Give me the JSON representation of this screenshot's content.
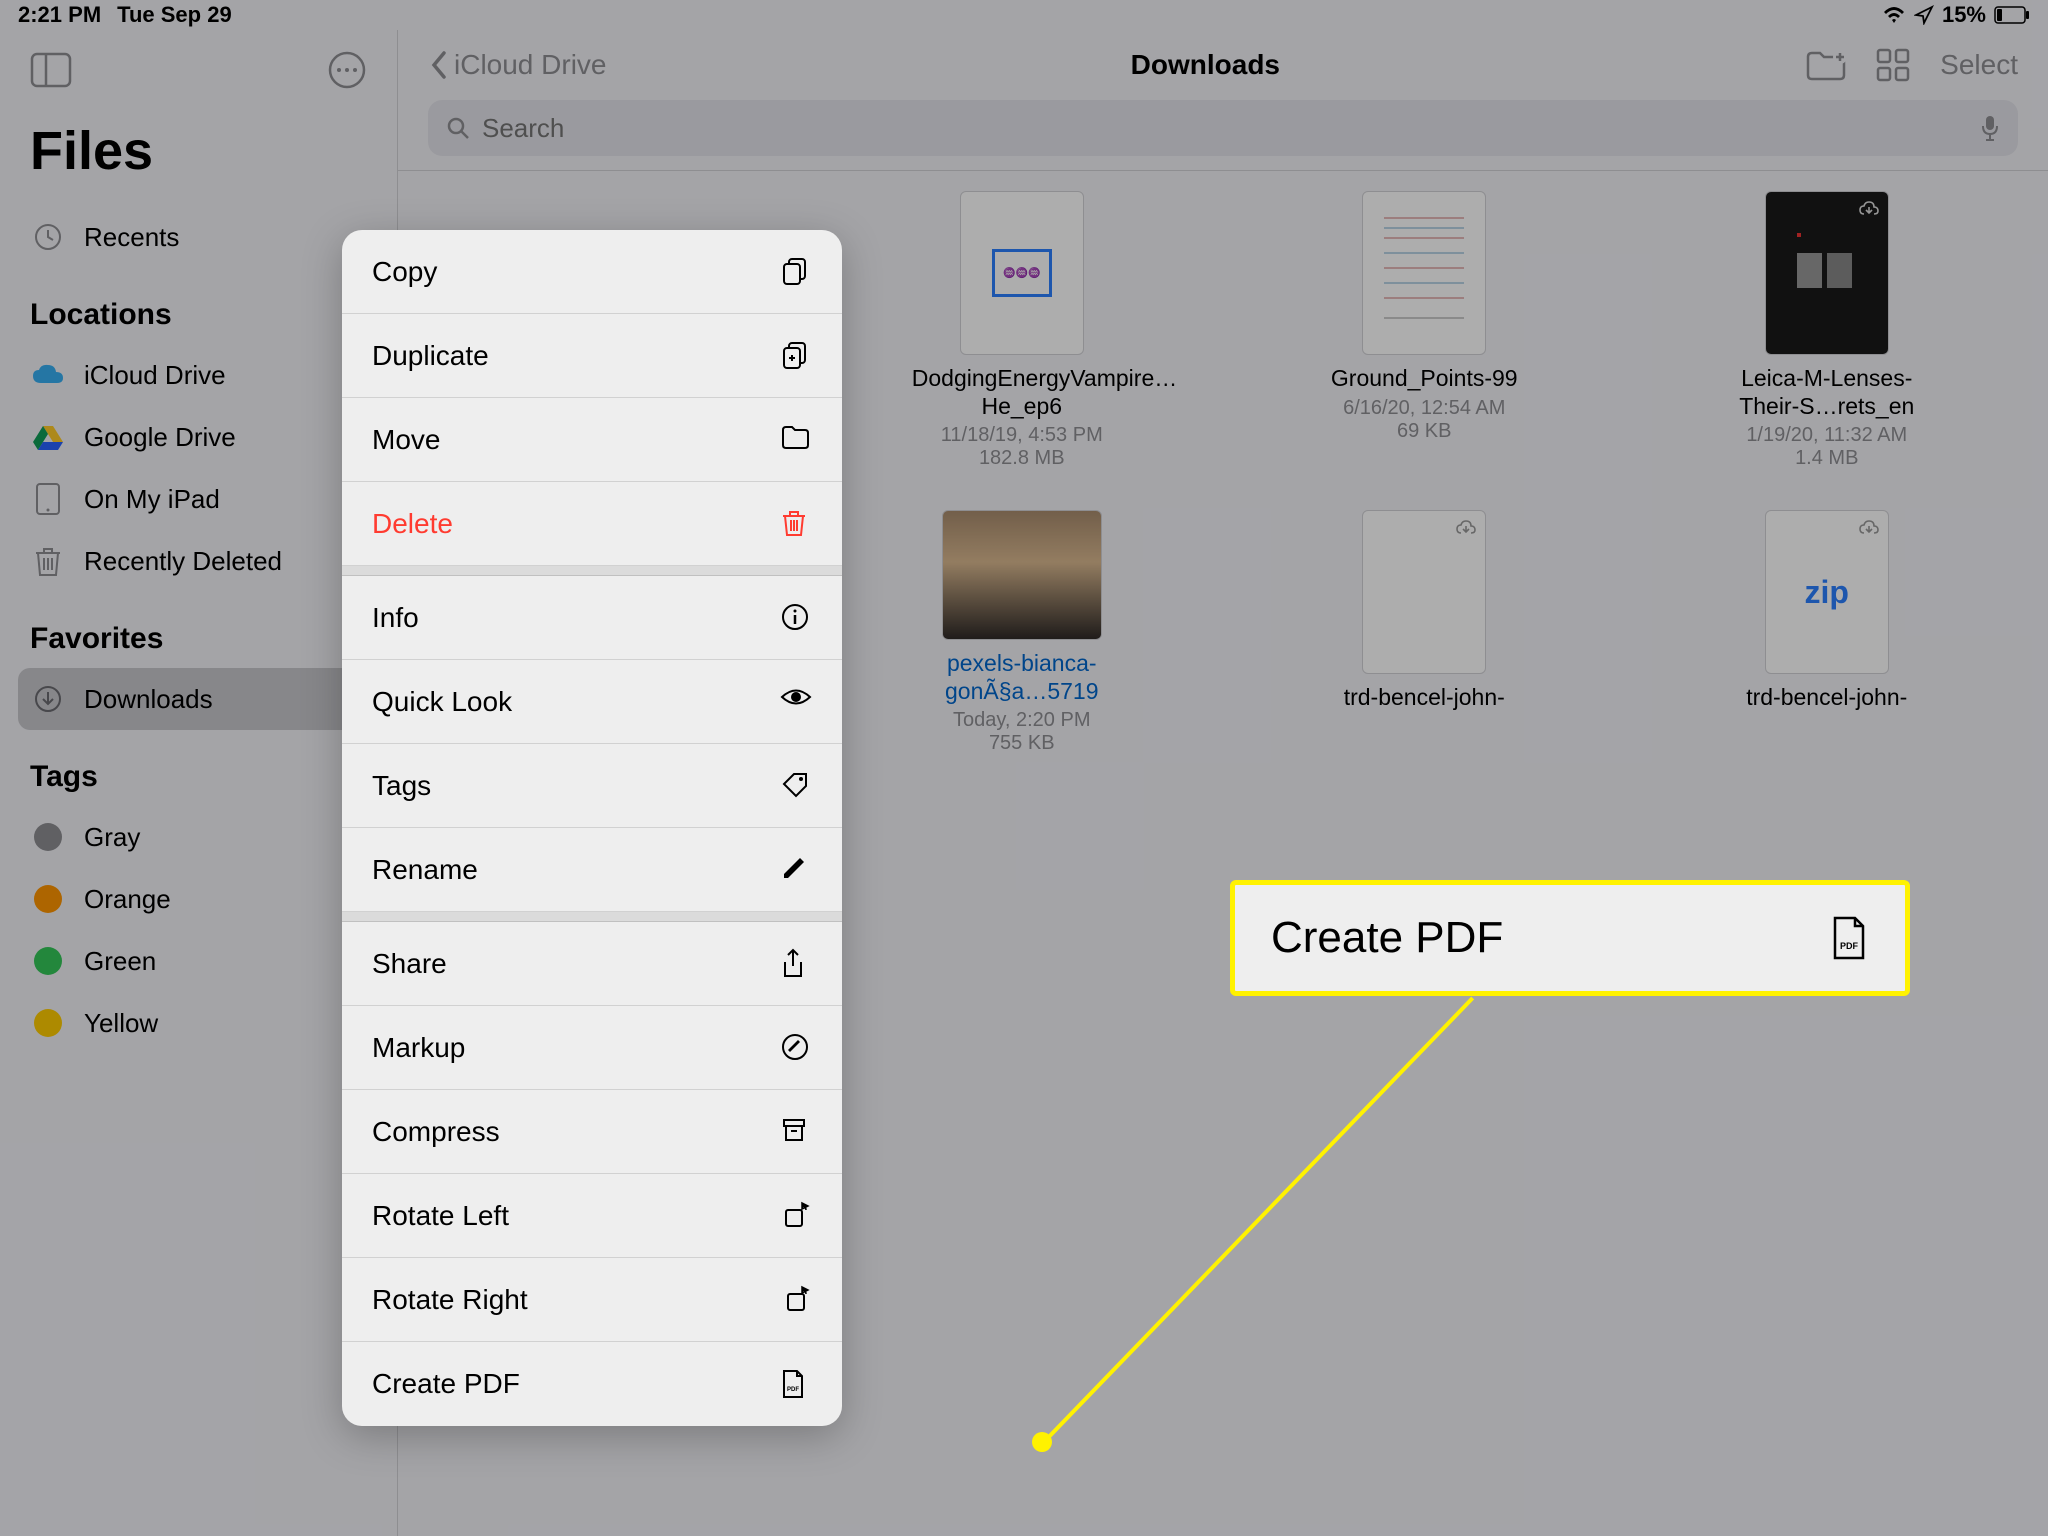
{
  "status": {
    "time": "2:21 PM",
    "date": "Tue Sep 29",
    "battery": "15%"
  },
  "sidebar": {
    "title": "Files",
    "recents": "Recents",
    "locations_header": "Locations",
    "locations": [
      {
        "label": "iCloud Drive"
      },
      {
        "label": "Google Drive"
      },
      {
        "label": "On My iPad"
      },
      {
        "label": "Recently Deleted"
      }
    ],
    "favorites_header": "Favorites",
    "favorites": [
      {
        "label": "Downloads"
      }
    ],
    "tags_header": "Tags",
    "tags": [
      {
        "label": "Gray",
        "color": "#8e8e93"
      },
      {
        "label": "Orange",
        "color": "#ff9500"
      },
      {
        "label": "Green",
        "color": "#34c759"
      },
      {
        "label": "Yellow",
        "color": "#ffcc00"
      }
    ]
  },
  "header": {
    "back": "iCloud Drive",
    "title": "Downloads",
    "select": "Select"
  },
  "search": {
    "placeholder": "Search"
  },
  "files": [
    {
      "name": "DodgingEnergyVampire…He_ep6",
      "date": "11/18/19, 4:53 PM",
      "size": "182.8 MB"
    },
    {
      "name": "Ground_Points-99",
      "date": "6/16/20, 12:54 AM",
      "size": "69 KB"
    },
    {
      "name": "Leica-M-Lenses-Their-S…rets_en",
      "date": "1/19/20, 11:32 AM",
      "size": "1.4 MB"
    },
    {
      "name": "pexels-bianca-gonÃ§a…5719",
      "date": "Today, 2:20 PM",
      "size": "755 KB"
    },
    {
      "name": "trd-bencel-john-",
      "date": "",
      "size": ""
    },
    {
      "name": "trd-bencel-john-",
      "date": "",
      "size": ""
    }
  ],
  "menu": {
    "copy": "Copy",
    "duplicate": "Duplicate",
    "move": "Move",
    "delete": "Delete",
    "info": "Info",
    "quick_look": "Quick Look",
    "tags": "Tags",
    "rename": "Rename",
    "share": "Share",
    "markup": "Markup",
    "compress": "Compress",
    "rotate_left": "Rotate Left",
    "rotate_right": "Rotate Right",
    "create_pdf": "Create PDF"
  },
  "callout": {
    "label": "Create PDF"
  }
}
